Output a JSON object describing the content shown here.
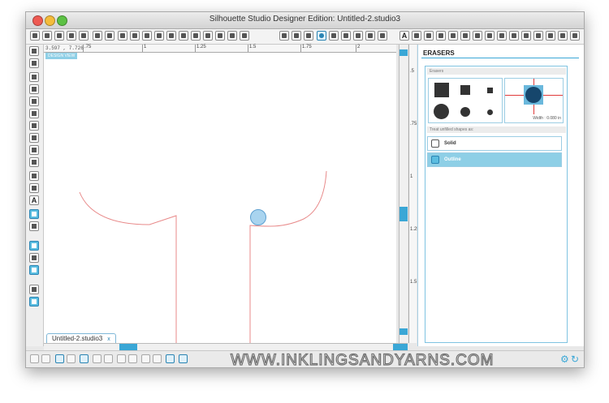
{
  "window": {
    "title": "Silhouette Studio Designer Edition: Untitled-2.studio3"
  },
  "canvas": {
    "coords": "3.597 , 7.726",
    "design_view_label": "DESIGN VIEW",
    "ruler_labels": [
      ".75",
      "1",
      "1.25",
      "1.5",
      "1.75",
      "2"
    ],
    "ruler_right_labels": [
      ".5",
      ".75",
      "1",
      "1.25",
      "1.5"
    ],
    "doc_tab": "Untitled-2.studio3",
    "doc_tab_close": "x"
  },
  "panel": {
    "title": "ERASERS",
    "erasers_label": "Erasers",
    "width_text": "Width : 0.080 in",
    "treat_label": "Treat unfilled shapes as:",
    "options": [
      {
        "label": "Solid",
        "selected": false
      },
      {
        "label": "Outline",
        "selected": true
      }
    ]
  },
  "watermark": "WWW.INKLINGSANDYARNS.COM",
  "colors": {
    "accent": "#3aa7d6",
    "line": "#e88a8a",
    "eraser_fill": "#a9d4ef",
    "preview_circle": "#16466c"
  },
  "icons": {
    "toolbar": [
      "new-document-icon",
      "open-icon",
      "template-icon",
      "save-icon",
      "save-library-icon",
      "print-icon",
      "print-cut-icon",
      "send-icon",
      "copy-icon",
      "paste-icon",
      "cut-icon",
      "undo-icon",
      "redo-icon",
      "pan-icon",
      "zoom-in-icon",
      "zoom-out-icon",
      "zoom-select-icon",
      "drag-zoom-icon",
      "fit-page-icon"
    ],
    "toolbar_right": [
      "library-icon",
      "page-setup-icon",
      "grid-icon",
      "fill-color-icon",
      "gradient-icon",
      "fill-pattern-icon",
      "line-color-icon",
      "line-style-icon",
      "text-style-icon",
      "text-icon",
      "trace-icon",
      "replicate-icon",
      "modify-icon",
      "knife-icon",
      "offset-icon",
      "eraser-panel-icon",
      "transform-icon",
      "align-icon",
      "send-silhouette-icon",
      "store-icon",
      "cut-settings-icon",
      "sketch-icon",
      "library-panel-icon",
      "shopping-icon"
    ]
  }
}
